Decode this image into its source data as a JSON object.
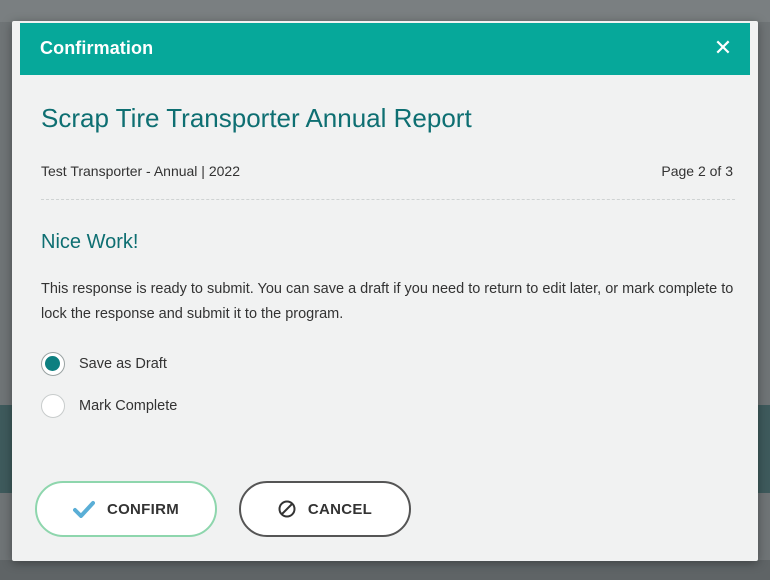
{
  "modal": {
    "header_title": "Confirmation",
    "close_glyph": "✕",
    "report_title": "Scrap Tire Transporter Annual Report",
    "response_name": "Test Transporter - Annual | 2022",
    "page_indicator": "Page 2 of 3",
    "subheading": "Nice Work!",
    "description": "This response is ready to submit. You can save a draft if you need to return to edit later, or mark complete to lock the response and submit it to the program.",
    "options": [
      {
        "label": "Save as Draft",
        "selected": true
      },
      {
        "label": "Mark Complete",
        "selected": false
      }
    ],
    "confirm_label": "CONFIRM",
    "cancel_label": "CANCEL"
  },
  "icons": {
    "close": "close-icon",
    "confirm": "checkmark-icon",
    "cancel": "ban-icon"
  },
  "colors": {
    "header": "#06a89a",
    "title_text": "#0e6f72",
    "radio_selected": "#0d7f80",
    "confirm_border": "#8ed6ad",
    "checkmark": "#5aaed6"
  }
}
